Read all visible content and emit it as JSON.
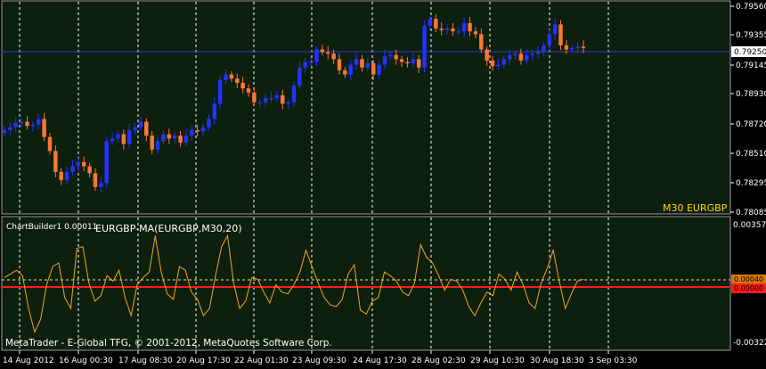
{
  "main_chart": {
    "price_labels": [
      "0.79560",
      "0.79355",
      "0.79145",
      "0.78930",
      "0.78720",
      "0.78510",
      "0.78295",
      "0.78085"
    ],
    "current_price": "0.79250",
    "symbol_label": "M30 EURGBP",
    "price_range": [
      0.7807,
      0.7957
    ]
  },
  "indicator": {
    "name_label": "ChartBuilder1 0.00011",
    "formula_label": "EURGBP-MA(EURGBP,M30,20)",
    "scale_labels": [
      "0.00357",
      "-0.00322"
    ],
    "level_labels": [
      "0.00040",
      "0.00000"
    ],
    "range": [
      -0.0034,
      0.0037
    ]
  },
  "time_axis": {
    "labels": [
      "14 Aug 2012",
      "16 Aug 00:30",
      "17 Aug 08:30",
      "20 Aug 17:30",
      "22 Aug 01:30",
      "23 Aug 09:30",
      "24 Aug 17:30",
      "28 Aug 02:30",
      "29 Aug 10:30",
      "30 Aug 18:30",
      "3 Sep 03:30"
    ]
  },
  "copyright": "MetaTrader - E-Global TFG, © 2001-2012, MetaQuotes Software Corp.",
  "colors": {
    "background": "#000000",
    "chart_background": "#0d1f0d",
    "grid": "#ffffff",
    "bull_candle": "#2233ff",
    "bear_candle": "#ff7733",
    "price_line": "#3b3bd6",
    "indicator_line": "#f5a623",
    "zero_line": "#ff1a1a",
    "level_line": "#ffe27a",
    "symbol_label": "#ffd700",
    "text": "#ffffff"
  },
  "chart_data": {
    "type": "line",
    "title": "M30 EURGBP",
    "series": [
      {
        "name": "EURGBP",
        "values": [
          0.7866,
          0.7868,
          0.7871,
          0.7872,
          0.7869,
          0.787,
          0.7874,
          0.7861,
          0.7851,
          0.7836,
          0.783,
          0.7836,
          0.784,
          0.7843,
          0.784,
          0.7835,
          0.7825,
          0.7828,
          0.7858,
          0.786,
          0.7863,
          0.7856,
          0.7866,
          0.7868,
          0.7872,
          0.7862,
          0.7852,
          0.7858,
          0.7863,
          0.786,
          0.7862,
          0.7857,
          0.7862,
          0.7866,
          0.7865,
          0.7868,
          0.7874,
          0.7885,
          0.7902,
          0.7906,
          0.7903,
          0.79,
          0.7896,
          0.7893,
          0.7886,
          0.7886,
          0.7889,
          0.7889,
          0.7891,
          0.7885,
          0.7886,
          0.7898,
          0.7911,
          0.7915,
          0.7915,
          0.7924,
          0.7922,
          0.7921,
          0.7917,
          0.7909,
          0.7906,
          0.7913,
          0.7917,
          0.7911,
          0.7914,
          0.7906,
          0.7913,
          0.7919,
          0.792,
          0.7917,
          0.7915,
          0.7914,
          0.7917,
          0.7911,
          0.7941,
          0.7946,
          0.7939,
          0.7938,
          0.7939,
          0.7937,
          0.7937,
          0.7943,
          0.7937,
          0.7935,
          0.7924,
          0.7916,
          0.7912,
          0.7913,
          0.7917,
          0.792,
          0.7921,
          0.7916,
          0.792,
          0.7921,
          0.7922,
          0.7927,
          0.7935,
          0.7942,
          0.7927,
          0.7924,
          0.7925,
          0.7926,
          0.7925
        ]
      },
      {
        "name": "EURGBP-MA(EURGBP,M30,20)",
        "values": [
          0.0005,
          0.0007,
          0.0009,
          0.0006,
          -0.0012,
          -0.0025,
          -0.0018,
          0.0001,
          0.0011,
          0.0013,
          -0.0006,
          -0.0012,
          0.0021,
          0.0022,
          0.0002,
          -0.0008,
          -0.0005,
          0.0006,
          0.0003,
          0.0009,
          -0.0006,
          -0.0016,
          0.0001,
          0.0005,
          0.0008,
          0.0028,
          0.0008,
          -0.0004,
          -0.0007,
          0.0011,
          0.0009,
          -0.0003,
          -0.0007,
          -0.0016,
          -0.0012,
          0.0006,
          0.0022,
          0.0028,
          0.0002,
          -0.0012,
          -0.0008,
          0.0005,
          0.0004,
          -0.0003,
          -0.0009,
          0.0001,
          -0.0003,
          -0.0004,
          0.0001,
          0.0008,
          0.002,
          0.0011,
          0.0002,
          -0.0006,
          -0.001,
          -0.0011,
          -0.0007,
          0.0007,
          0.0012,
          -0.0013,
          -0.0015,
          -0.0008,
          -0.0006,
          0.0008,
          0.0006,
          0.0003,
          -0.0003,
          -0.0005,
          0.0002,
          0.0023,
          0.0016,
          0.0013,
          0.0006,
          -0.0002,
          0.0004,
          0.0003,
          -0.0002,
          -0.0011,
          -0.0016,
          -0.0009,
          -0.0003,
          -0.0005,
          0.0007,
          0.0004,
          -0.0002,
          0.0008,
          0.0001,
          -0.0009,
          -0.0012,
          0.0002,
          0.001,
          0.002,
          0.0003,
          -0.0012,
          -0.0004,
          0.0003,
          0.0004
        ]
      }
    ],
    "ylim_main": [
      0.7807,
      0.7957
    ],
    "ylim_indicator": [
      -0.0034,
      0.0037
    ],
    "grid": true
  }
}
